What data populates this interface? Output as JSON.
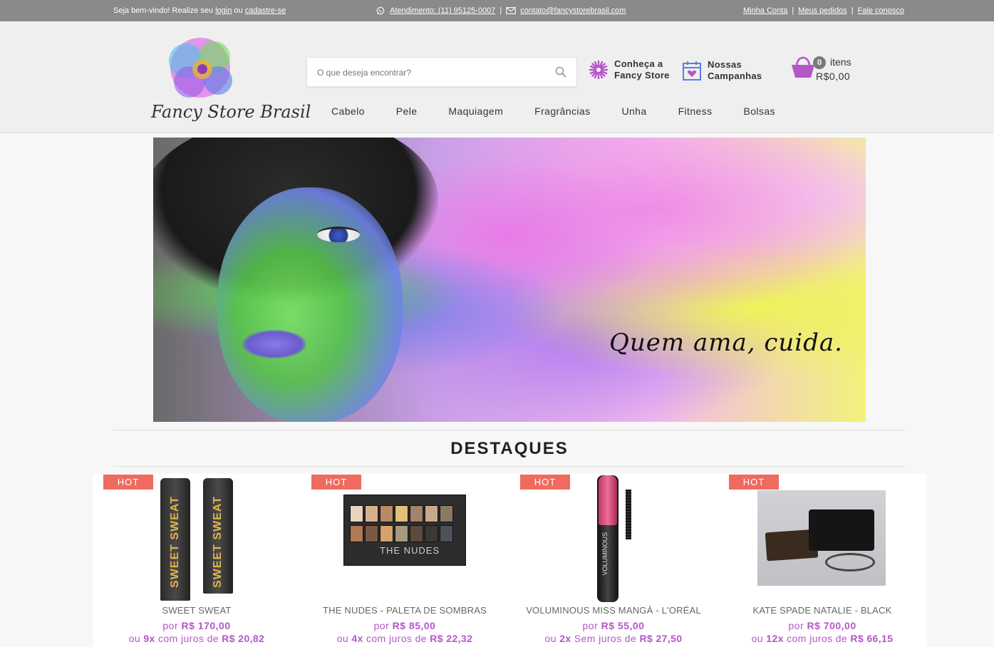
{
  "topbar": {
    "welcome": "Seja bem-vindo! Realize seu",
    "login": "login",
    "or": "ou",
    "register": "cadastre-se",
    "phone": "Atendimento: (11) 95125-0007",
    "email": "contato@fancystorebrasil.com",
    "links": [
      "Minha Conta",
      "Meus pedidos",
      "Fale conosco"
    ],
    "separator": "|"
  },
  "header": {
    "logo_text": "Fancy Store Brasil",
    "search_placeholder": "O que deseja encontrar?",
    "about_line1": "Conheça a",
    "about_line2": "Fancy Store",
    "campaigns_line1": "Nossas",
    "campaigns_line2": "Campanhas",
    "cart_count": "0",
    "cart_items_label": "itens",
    "cart_total": "R$0,00",
    "accent_color": "#b556c9"
  },
  "nav": [
    "Cabelo",
    "Pele",
    "Maquiagem",
    "Fragrâncias",
    "Unha",
    "Fitness",
    "Bolsas"
  ],
  "banner": {
    "slogan": "Quem ama, cuida."
  },
  "section_title": "DESTAQUES",
  "products": [
    {
      "badge": "HOT",
      "name": "SWEET SWEAT",
      "price_prefix": "por",
      "price": "R$ 170,00",
      "inst_prefix": "ou",
      "inst_times": "9x",
      "inst_mid": "com juros de",
      "inst_value": "R$ 20,82"
    },
    {
      "badge": "HOT",
      "name": "THE NUDES - PALETA DE SOMBRAS",
      "price_prefix": "por",
      "price": "R$ 85,00",
      "inst_prefix": "ou",
      "inst_times": "4x",
      "inst_mid": "com juros de",
      "inst_value": "R$ 22,32"
    },
    {
      "badge": "HOT",
      "name": "VOLUMINOUS MISS MANGÁ - L'ORÉAL",
      "price_prefix": "por",
      "price": "R$ 55,00",
      "inst_prefix": "ou",
      "inst_times": "2x",
      "inst_mid": "Sem juros de",
      "inst_value": "R$ 27,50"
    },
    {
      "badge": "HOT",
      "name": "KATE SPADE NATALIE - BLACK",
      "price_prefix": "por",
      "price": "R$ 700,00",
      "inst_prefix": "ou",
      "inst_times": "12x",
      "inst_mid": "com juros de",
      "inst_value": "R$ 66,15"
    }
  ],
  "product_art": {
    "tube_label": "SWEET SWEAT",
    "palette_label": "THE NUDES",
    "mascara_label": "VOLUMINOUS"
  }
}
